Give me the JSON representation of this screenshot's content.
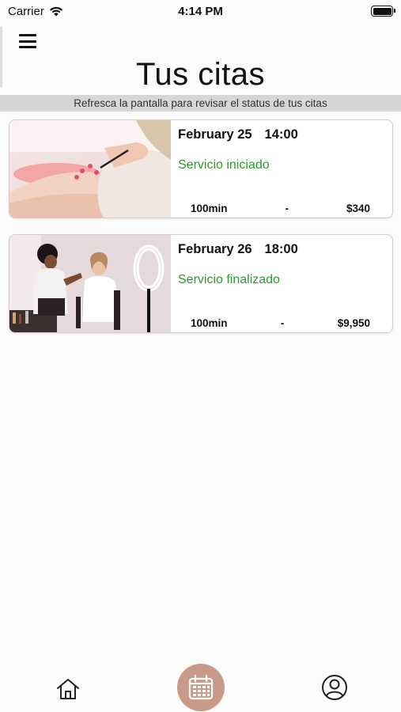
{
  "status_bar": {
    "carrier": "Carrier",
    "time": "4:14 PM",
    "wifi_icon": "wifi-icon",
    "battery_icon": "battery-icon",
    "battery_level": 1.0
  },
  "header": {
    "menu_icon": "hamburger-menu-icon",
    "title": "Tus citas",
    "subtitle": "Refresca la pantalla para revisar el status de tus citas"
  },
  "appointments": [
    {
      "date": "February 25",
      "time": "14:00",
      "status": "Servicio iniciado",
      "duration": "100min",
      "separator": "-",
      "price": "$340",
      "image": "manicure-photo"
    },
    {
      "date": "February 26",
      "time": "18:00",
      "status": "Servicio finalizado",
      "duration": "100min",
      "separator": "-",
      "price": "$9,950",
      "image": "makeup-artist-photo"
    }
  ],
  "tab_bar": {
    "home_icon": "home-icon",
    "calendar_icon": "calendar-icon",
    "profile_icon": "profile-icon"
  },
  "colors": {
    "status_green": "#2a9a2a",
    "accent_rose": "#c99a88",
    "subtitle_bar": "#d6d6d6"
  }
}
